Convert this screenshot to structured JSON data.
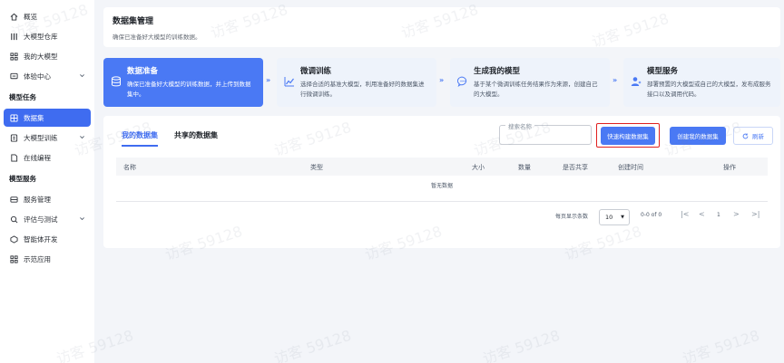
{
  "sidebar": {
    "items": [
      {
        "label": "概览",
        "icon": "home-icon"
      },
      {
        "label": "大模型仓库",
        "icon": "grid-icon"
      },
      {
        "label": "我的大模型",
        "icon": "apps-icon"
      },
      {
        "label": "体验中心",
        "icon": "chat-icon",
        "has_children": true
      }
    ],
    "group1": "模型任务",
    "group1_items": [
      {
        "label": "数据集",
        "icon": "database-icon",
        "active": true
      },
      {
        "label": "大模型训练",
        "icon": "train-icon",
        "has_children": true
      },
      {
        "label": "在线编程",
        "icon": "code-icon"
      }
    ],
    "group2": "模型服务",
    "group2_items": [
      {
        "label": "服务管理",
        "icon": "server-icon"
      },
      {
        "label": "评估与测试",
        "icon": "evaluate-icon",
        "has_children": true
      },
      {
        "label": "智能体开发",
        "icon": "agent-icon"
      },
      {
        "label": "示范应用",
        "icon": "apps-icon"
      }
    ]
  },
  "header": {
    "title": "数据集管理",
    "subtitle": "确保已准备好大模型的训练数据。"
  },
  "steps": [
    {
      "title": "数据准备",
      "desc": "确保已准备好大模型的训练数据，并上传到数据集中。",
      "icon": "database-icon"
    },
    {
      "title": "微调训练",
      "desc": "选择合适的基准大模型，利用准备好的数据集进行微调训练。",
      "icon": "chart-icon"
    },
    {
      "title": "生成我的模型",
      "desc": "基于某个微调训练任务结果作为来源，创建自己的大模型。",
      "icon": "chat-bubble-icon"
    },
    {
      "title": "模型服务",
      "desc": "部署预置的大模型或自己的大模型，发布成服务接口以及调用代码。",
      "icon": "user-service-icon"
    }
  ],
  "tabs": [
    "我的数据集",
    "共享的数据集"
  ],
  "search": {
    "label": "搜索名称",
    "value": ""
  },
  "buttons": {
    "quick_build": "快速构建数据集",
    "create": "创建我的数据集",
    "refresh": "刷新"
  },
  "table": {
    "columns": [
      "名称",
      "类型",
      "大小",
      "数量",
      "是否共享",
      "创建时间",
      "操作"
    ],
    "empty": "暂无数据"
  },
  "pagination": {
    "rows_per_page_label": "每页显示条数",
    "rows_per_page": "10",
    "range": "0-0 of 0",
    "page": "1"
  },
  "watermark": "访客 59128",
  "colors": {
    "accent": "#4a79f4",
    "highlight": "#e02020"
  }
}
